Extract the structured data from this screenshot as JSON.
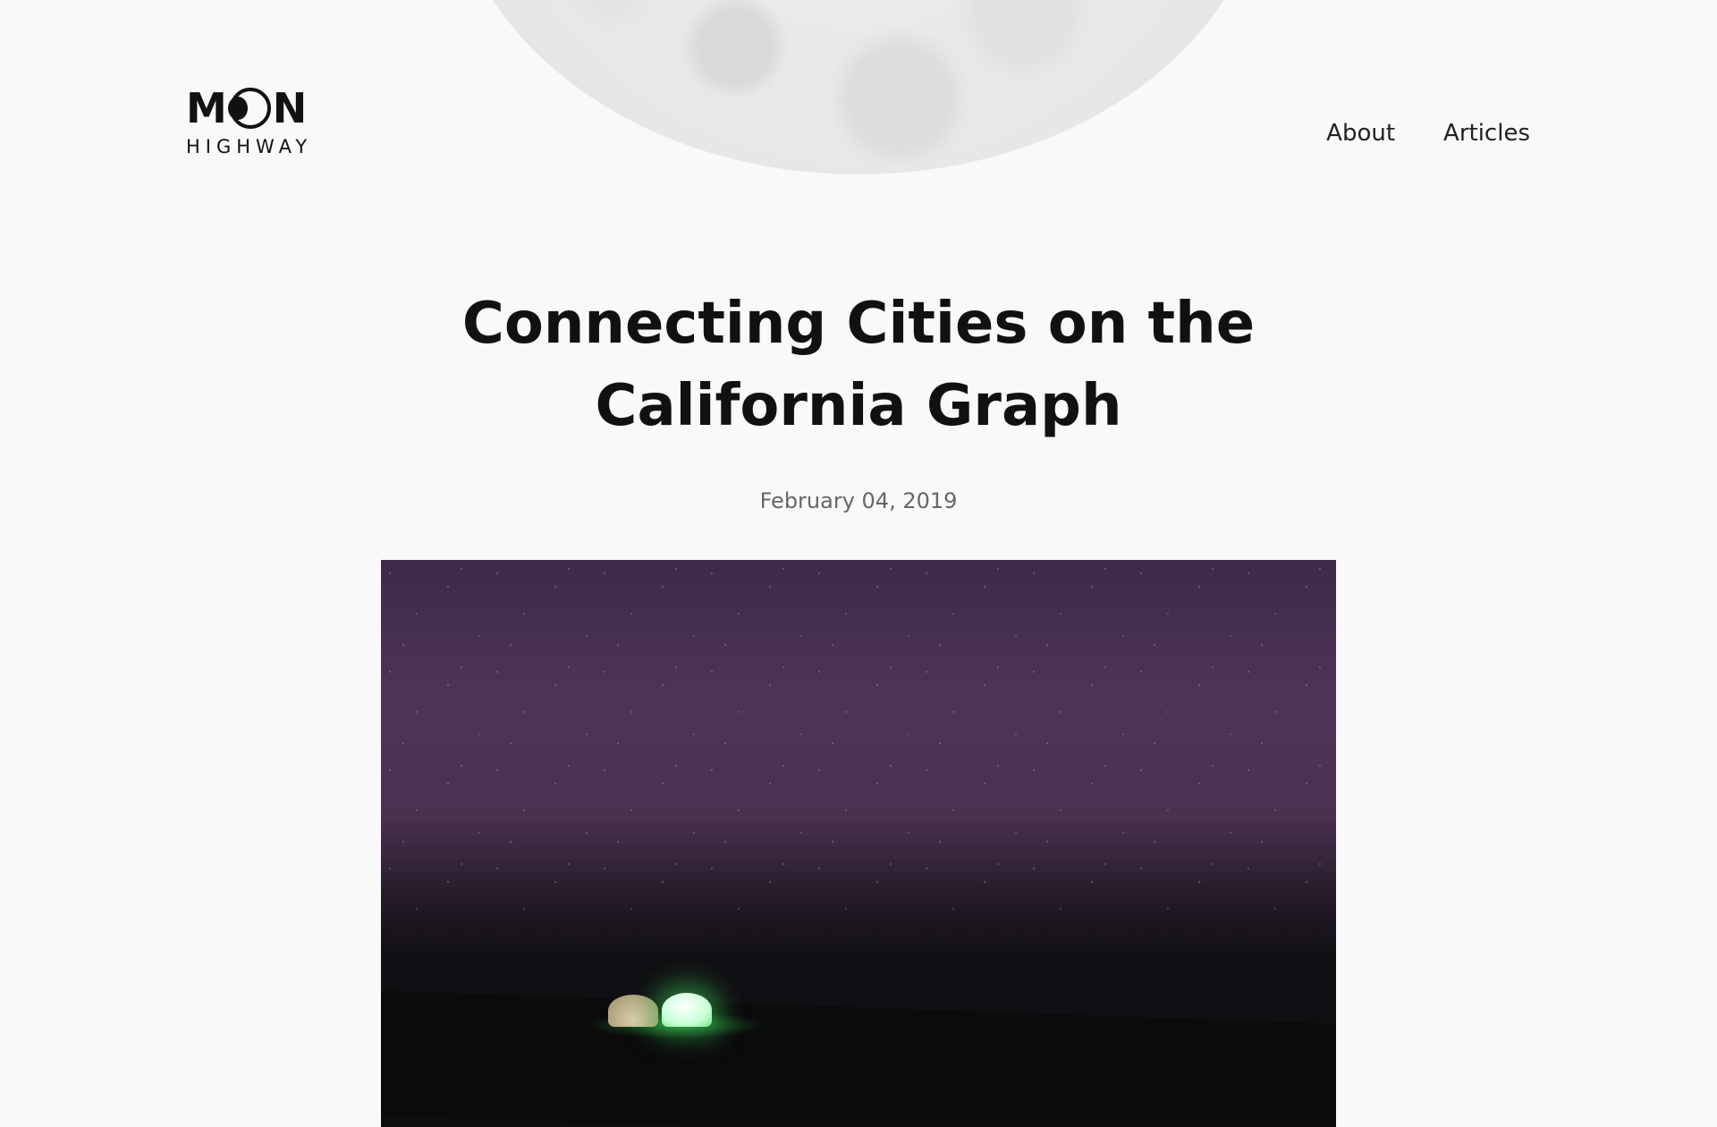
{
  "brand": {
    "logo_line1": "MOON",
    "logo_line2": "HIGHWAY"
  },
  "nav": {
    "items": [
      {
        "label": "About"
      },
      {
        "label": "Articles"
      }
    ]
  },
  "article": {
    "title": "Connecting Cities on the California Graph",
    "date": "February 04, 2019"
  }
}
